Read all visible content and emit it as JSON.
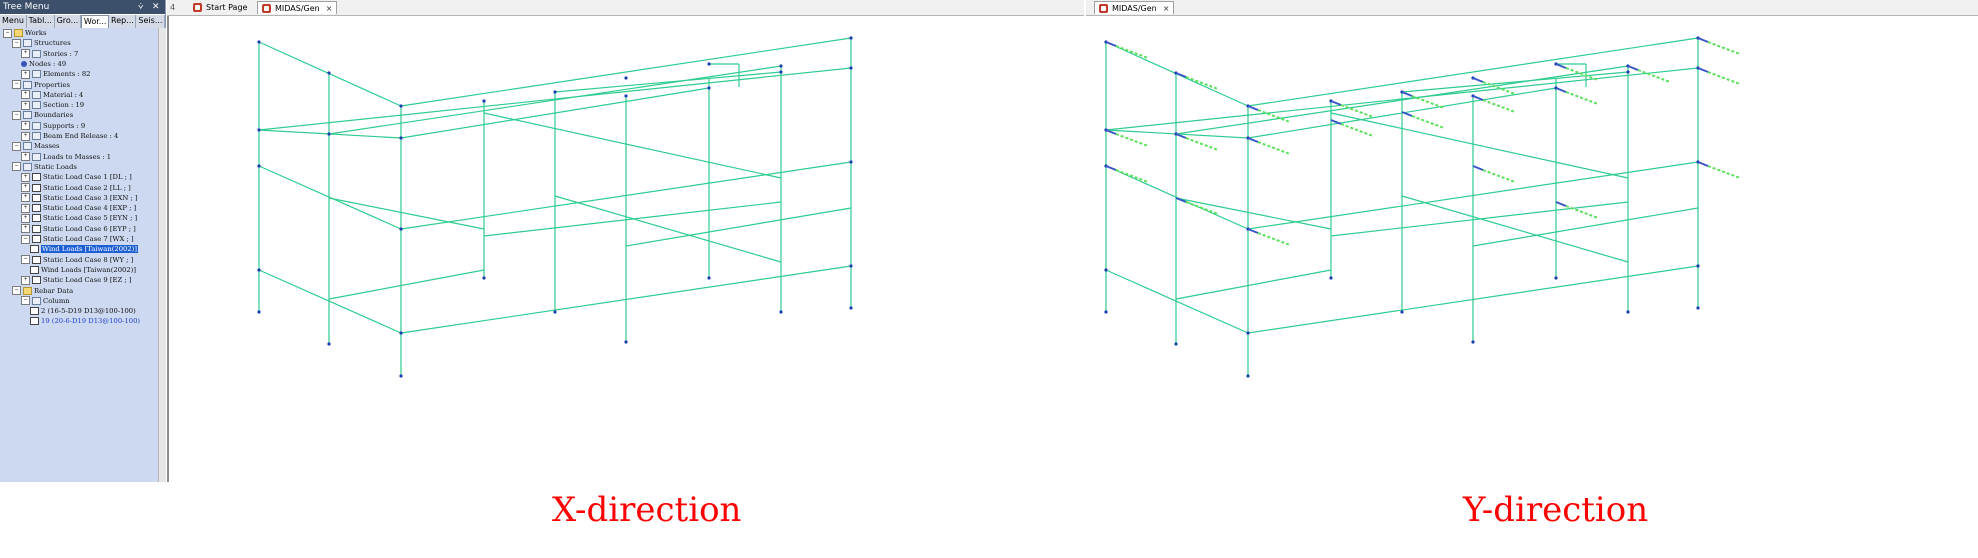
{
  "tree_menu": {
    "title": "Tree Menu",
    "pin": "⩒",
    "close": "✕",
    "tabs": [
      "Menu",
      "Tabl...",
      "Gro...",
      "Wor...",
      "Rep...",
      "Seis..."
    ],
    "active_tab": 3,
    "nodes": [
      {
        "text": "Works",
        "level": 0,
        "toggle": "-",
        "icon": "folder-icon"
      },
      {
        "text": "Structures",
        "level": 1,
        "toggle": "-",
        "icon": "structure-icon"
      },
      {
        "text": "Stories : 7",
        "level": 2,
        "toggle": "+",
        "icon": "stories-icon"
      },
      {
        "text": "Nodes : 49",
        "level": 2,
        "toggle": "",
        "icon": "node-icon"
      },
      {
        "text": "Elements : 82",
        "level": 2,
        "toggle": "+",
        "icon": "elements-icon"
      },
      {
        "text": "Properties",
        "level": 1,
        "toggle": "-",
        "icon": "properties-icon"
      },
      {
        "text": "Material : 4",
        "level": 2,
        "toggle": "+",
        "icon": "material-icon"
      },
      {
        "text": "Section : 19",
        "level": 2,
        "toggle": "+",
        "icon": "section-icon"
      },
      {
        "text": "Boundaries",
        "level": 1,
        "toggle": "-",
        "icon": "boundaries-icon"
      },
      {
        "text": "Supports : 9",
        "level": 2,
        "toggle": "+",
        "icon": "support-icon"
      },
      {
        "text": "Beam End Release : 4",
        "level": 2,
        "toggle": "+",
        "icon": "beam-release-icon"
      },
      {
        "text": "Masses",
        "level": 1,
        "toggle": "-",
        "icon": "masses-icon"
      },
      {
        "text": "Loads to Masses : 1",
        "level": 2,
        "toggle": "+",
        "icon": "loads-to-masses-icon"
      },
      {
        "text": "Static Loads",
        "level": 1,
        "toggle": "-",
        "icon": "static-loads-icon"
      },
      {
        "text": "Static Load Case 1 [DL ; ]",
        "level": 2,
        "toggle": "+",
        "icon": "load-case-icon"
      },
      {
        "text": "Static Load Case 2 [LL ; ]",
        "level": 2,
        "toggle": "+",
        "icon": "load-case-icon"
      },
      {
        "text": "Static Load Case 3 [EXN ; ]",
        "level": 2,
        "toggle": "+",
        "icon": "load-case-icon"
      },
      {
        "text": "Static Load Case 4 [EXP ; ]",
        "level": 2,
        "toggle": "+",
        "icon": "load-case-icon"
      },
      {
        "text": "Static Load Case 5 [EYN ; ]",
        "level": 2,
        "toggle": "+",
        "icon": "load-case-icon"
      },
      {
        "text": "Static Load Case 6 [EYP ; ]",
        "level": 2,
        "toggle": "+",
        "icon": "load-case-icon"
      },
      {
        "text": "Static Load Case 7 [WX ; ]",
        "level": 2,
        "toggle": "-",
        "icon": "load-case-icon"
      },
      {
        "text": "Wind Loads [Taiwan(2002)]",
        "level": 3,
        "toggle": "",
        "icon": "wind-load-icon",
        "selected": true
      },
      {
        "text": "Static Load Case 8 [WY ; ]",
        "level": 2,
        "toggle": "-",
        "icon": "load-case-icon"
      },
      {
        "text": "Wind Loads [Taiwan(2002)]",
        "level": 3,
        "toggle": "",
        "icon": "wind-load-icon"
      },
      {
        "text": "Static Load Case 9 [EZ ; ]",
        "level": 2,
        "toggle": "+",
        "icon": "load-case-icon"
      },
      {
        "text": "Rebar Data",
        "level": 1,
        "toggle": "-",
        "icon": "rebar-icon"
      },
      {
        "text": "Column",
        "level": 2,
        "toggle": "-",
        "icon": "column-icon"
      },
      {
        "text": "2 (16-5-D19 D13@100-100)",
        "level": 3,
        "toggle": "",
        "icon": "column-section-icon"
      },
      {
        "text": "19 (20-6-D19 D13@100-100)",
        "level": 3,
        "toggle": "",
        "icon": "column-section-icon",
        "blue": true
      }
    ]
  },
  "left_tabs": {
    "overflow": "4",
    "start_page": "Start Page",
    "active": "MIDAS/Gen",
    "close": "×"
  },
  "right_tabs": {
    "active": "MIDAS/Gen",
    "close": "×"
  },
  "captions": {
    "x": "X-direction",
    "y": "Y-direction"
  },
  "colors": {
    "frame": "#2ecc8f",
    "node": "#1b3fb0",
    "load_arrow": "#3a55c8",
    "load_label": "#5be05b",
    "caption": "#ff0000",
    "tree_bg": "#cdd9f0",
    "selection": "#1c5fd4"
  }
}
